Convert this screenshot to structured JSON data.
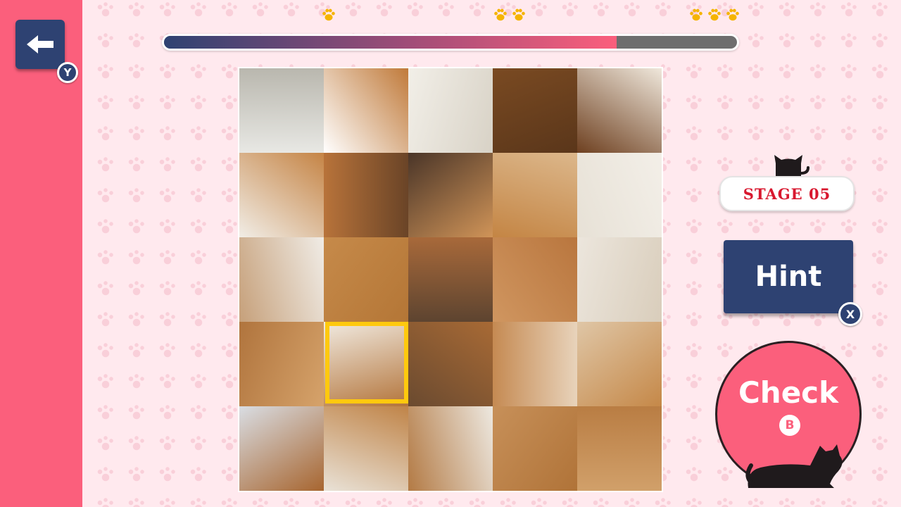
{
  "controls": {
    "back_badge": "Y",
    "hint_label": "Hint",
    "hint_badge": "X",
    "check_label": "Check",
    "check_badge": "B"
  },
  "stage": {
    "label": "STAGE  05"
  },
  "progress": {
    "fraction": 0.79,
    "milestones": [
      {
        "paws": 1
      },
      {
        "paws": 2
      },
      {
        "paws": 3
      }
    ]
  },
  "puzzle": {
    "rows": 5,
    "cols": 5,
    "selected_tile": {
      "row": 3,
      "col": 1
    }
  },
  "colors": {
    "accent_pink": "#fb5f7c",
    "navy": "#2e4272",
    "stage_red": "#d8182f",
    "selector_yellow": "#ffc90e",
    "paw_gold": "#f5b400"
  },
  "icons": {
    "back": "back-arrow-icon",
    "paw": "paw-icon",
    "cat": "cat-silhouette-icon"
  }
}
